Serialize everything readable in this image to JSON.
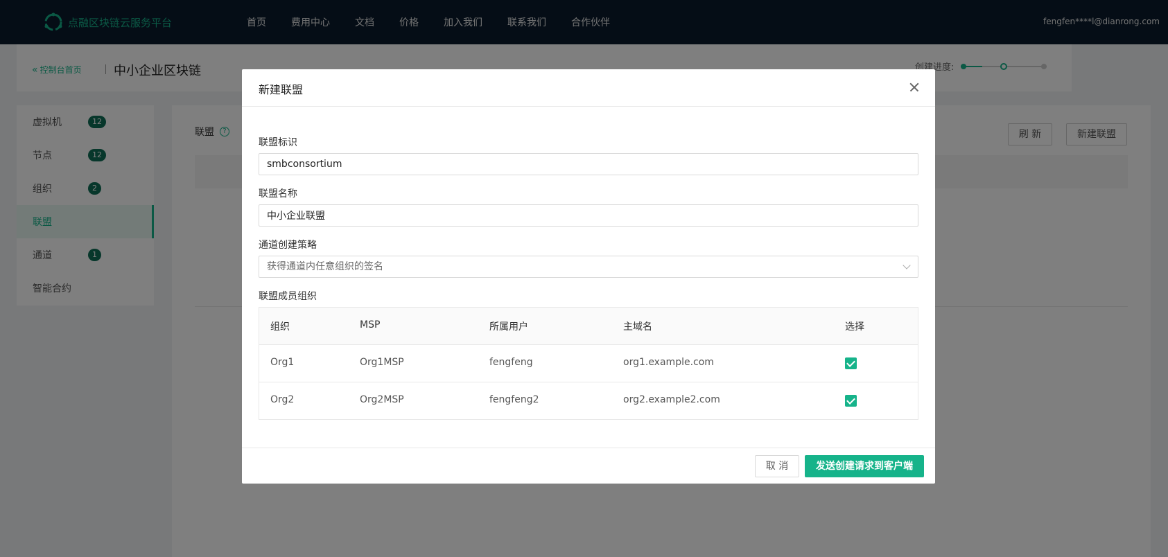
{
  "topnav": {
    "brand": "点融区块链云服务平台",
    "items": [
      "首页",
      "费用中心",
      "文档",
      "价格",
      "加入我们",
      "联系我们",
      "合作伙伴"
    ],
    "user": "fengfen****l@dianrong.com"
  },
  "header": {
    "back_label": "控制台首页",
    "title": "中小企业区块链",
    "progress_label": "创建进度:",
    "progress_step": 2,
    "progress_total": 3
  },
  "sidebar": {
    "items": [
      {
        "label": "虚拟机",
        "badge": "12"
      },
      {
        "label": "节点",
        "badge": "12"
      },
      {
        "label": "组织",
        "badge": "2"
      },
      {
        "label": "联盟",
        "badge": ""
      },
      {
        "label": "通道",
        "badge": "1"
      },
      {
        "label": "智能合约",
        "badge": ""
      }
    ],
    "active_index": 3
  },
  "content": {
    "title": "联盟",
    "refresh_label": "刷 新",
    "new_label": "新建联盟"
  },
  "modal": {
    "title": "新建联盟",
    "id_label": "联盟标识",
    "id_value": "smbconsortium",
    "name_label": "联盟名称",
    "name_value": "中小企业联盟",
    "policy_label": "通道创建策略",
    "policy_value": "获得通道内任意组织的签名",
    "members_label": "联盟成员组织",
    "table": {
      "headers": [
        "组织",
        "MSP",
        "所属用户",
        "主域名",
        "选择"
      ],
      "rows": [
        {
          "org": "Org1",
          "msp": "Org1MSP",
          "user": "fengfeng",
          "domain": "org1.example.com",
          "selected": true
        },
        {
          "org": "Org2",
          "msp": "Org2MSP",
          "user": "fengfeng2",
          "domain": "org2.example2.com",
          "selected": true
        }
      ]
    },
    "cancel_label": "取 消",
    "submit_label": "发送创建请求到客户端"
  },
  "colors": {
    "accent": "#16b38a",
    "nav_bg": "#0b1b2c"
  }
}
